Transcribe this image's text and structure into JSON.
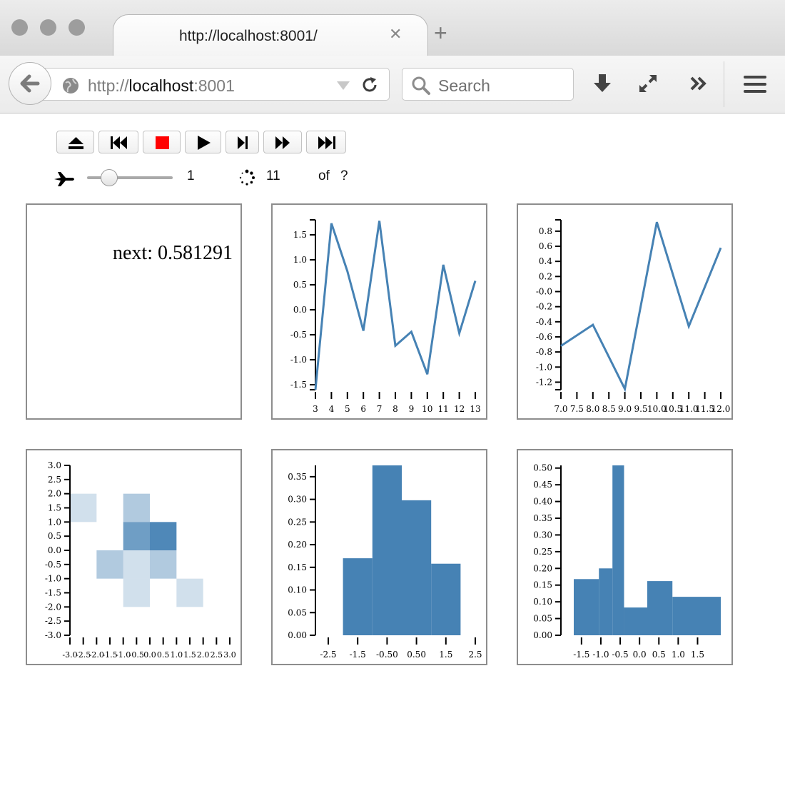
{
  "browser": {
    "tab_title": "http://localhost:8001/",
    "url_prefix": "http://",
    "url_host": "localhost",
    "url_port": ":8001",
    "search_placeholder": "Search",
    "close_glyph": "✕",
    "newtab_glyph": "+"
  },
  "player": {
    "speed_value": "1",
    "frame_current": "11",
    "frame_of": "of",
    "frame_total": "?",
    "speed_fraction": 0.25,
    "colors": {
      "stop": "#ff0000"
    }
  },
  "panels": {
    "text_output": "next: 0.581291"
  },
  "chart_data": [
    {
      "type": "line",
      "x": [
        3,
        4,
        5,
        6,
        7,
        8,
        9,
        10,
        11,
        12,
        13
      ],
      "y": [
        -1.6,
        1.73,
        0.77,
        -0.42,
        1.78,
        -0.72,
        -0.44,
        -1.29,
        0.9,
        -0.47,
        0.58
      ],
      "xlim": [
        3,
        13
      ],
      "ylim": [
        -1.6,
        1.8
      ],
      "xticks": [
        "3",
        "4",
        "5",
        "6",
        "7",
        "8",
        "9",
        "10",
        "11",
        "12",
        "13"
      ],
      "yticks": [
        "1.5",
        "1.0",
        "0.5",
        "0.0",
        "-0.5",
        "-1.0",
        "-1.5"
      ],
      "ytick_values": [
        1.5,
        1.0,
        0.5,
        0.0,
        -0.5,
        -1.0,
        -1.5
      ],
      "color": "#4682b4"
    },
    {
      "type": "line",
      "x": [
        7.0,
        8.0,
        9.0,
        10.0,
        11.0,
        12.0
      ],
      "y": [
        -0.72,
        -0.44,
        -1.29,
        0.92,
        -0.46,
        0.58
      ],
      "xlim": [
        7.0,
        12.0
      ],
      "ylim": [
        -1.3,
        0.95
      ],
      "xticks": [
        "7.0",
        "7.5",
        "8.0",
        "8.5",
        "9.0",
        "9.5",
        "10.0",
        "10.5",
        "11.0",
        "11.5",
        "12.0"
      ],
      "xtick_values": [
        7.0,
        7.5,
        8.0,
        8.5,
        9.0,
        9.5,
        10.0,
        10.5,
        11.0,
        11.5,
        12.0
      ],
      "yticks": [
        "0.8",
        "0.6",
        "0.4",
        "0.2",
        "-0.0",
        "-0.2",
        "-0.4",
        "-0.6",
        "-0.8",
        "-1.0",
        "-1.2"
      ],
      "ytick_values": [
        0.8,
        0.6,
        0.4,
        0.2,
        0.0,
        -0.2,
        -0.4,
        -0.6,
        -0.8,
        -1.0,
        -1.2
      ],
      "color": "#4682b4"
    },
    {
      "type": "heatmap",
      "xlim": [
        -3.0,
        3.0
      ],
      "ylim": [
        -3.0,
        3.0
      ],
      "xticks": [
        "-3.0",
        "-2.5",
        "-2.0",
        "-1.5",
        "-1.0",
        "-0.5",
        "0.0",
        "0.5",
        "1.0",
        "1.5",
        "2.0",
        "2.5",
        "3.0"
      ],
      "yticks": [
        "3.0",
        "2.5",
        "2.0",
        "1.5",
        "1.0",
        "0.5",
        "0.0",
        "-0.5",
        "-1.0",
        "-1.5",
        "-2.0",
        "-2.5",
        "-3.0"
      ],
      "tick_values": [
        -3.0,
        -2.5,
        -2.0,
        -1.5,
        -1.0,
        -0.5,
        0.0,
        0.5,
        1.0,
        1.5,
        2.0,
        2.5,
        3.0
      ],
      "cells": [
        {
          "x0": -3.0,
          "x1": -2.0,
          "y0": 1.0,
          "y1": 2.0,
          "value": 1
        },
        {
          "x0": -1.0,
          "x1": 0.0,
          "y0": 1.0,
          "y1": 2.0,
          "value": 2
        },
        {
          "x0": -1.0,
          "x1": 0.0,
          "y0": 0.0,
          "y1": 1.0,
          "value": 4
        },
        {
          "x0": 0.0,
          "x1": 1.0,
          "y0": 0.0,
          "y1": 1.0,
          "value": 5
        },
        {
          "x0": -2.0,
          "x1": -1.0,
          "y0": -1.0,
          "y1": 0.0,
          "value": 2
        },
        {
          "x0": -1.0,
          "x1": 0.0,
          "y0": -1.0,
          "y1": 0.0,
          "value": 1
        },
        {
          "x0": 0.0,
          "x1": 1.0,
          "y0": -1.0,
          "y1": 0.0,
          "value": 2
        },
        {
          "x0": -1.0,
          "x1": 0.0,
          "y0": -2.0,
          "y1": -1.0,
          "value": 1
        },
        {
          "x0": 1.0,
          "x1": 2.0,
          "y0": -2.0,
          "y1": -1.0,
          "value": 1
        }
      ],
      "color": "#4682b4"
    },
    {
      "type": "bar",
      "bins": [
        {
          "x0": -2.0,
          "x1": -1.0,
          "value": 0.17
        },
        {
          "x0": -1.0,
          "x1": 0.0,
          "value": 0.375
        },
        {
          "x0": 0.0,
          "x1": 1.0,
          "value": 0.298
        },
        {
          "x0": 1.0,
          "x1": 2.0,
          "value": 0.158
        }
      ],
      "xlim": [
        -2.5,
        2.5
      ],
      "ylim": [
        0,
        0.375
      ],
      "xticks": [
        "-2.5",
        "-1.5",
        "-0.50",
        "0.50",
        "1.5",
        "2.5"
      ],
      "xtick_values": [
        -2.5,
        -1.5,
        -0.5,
        0.5,
        1.5,
        2.5
      ],
      "yticks": [
        "0.35",
        "0.30",
        "0.25",
        "0.20",
        "0.15",
        "0.10",
        "0.05",
        "0.00"
      ],
      "ytick_values": [
        0.35,
        0.3,
        0.25,
        0.2,
        0.15,
        0.1,
        0.05,
        0.0
      ],
      "color": "#4682b4"
    },
    {
      "type": "bar",
      "bins": [
        {
          "x0": -1.7,
          "x1": -1.05,
          "value": 0.168
        },
        {
          "x0": -1.05,
          "x1": -0.7,
          "value": 0.2
        },
        {
          "x0": -0.7,
          "x1": -0.4,
          "value": 0.508
        },
        {
          "x0": -0.4,
          "x1": 0.2,
          "value": 0.083
        },
        {
          "x0": 0.2,
          "x1": 0.85,
          "value": 0.162
        },
        {
          "x0": 0.85,
          "x1": 2.1,
          "value": 0.115
        }
      ],
      "xlim": [
        -1.7,
        2.1
      ],
      "ylim": [
        0,
        0.508
      ],
      "xticks": [
        "-1.5",
        "-1.0",
        "-0.5",
        "0.0",
        "0.5",
        "1.0",
        "1.5"
      ],
      "xtick_values": [
        -1.5,
        -1.0,
        -0.5,
        0.0,
        0.5,
        1.0,
        1.5
      ],
      "yticks": [
        "0.50",
        "0.45",
        "0.40",
        "0.35",
        "0.30",
        "0.25",
        "0.20",
        "0.15",
        "0.10",
        "0.05",
        "0.00"
      ],
      "ytick_values": [
        0.5,
        0.45,
        0.4,
        0.35,
        0.3,
        0.25,
        0.2,
        0.15,
        0.1,
        0.05,
        0.0
      ],
      "color": "#4682b4"
    }
  ]
}
